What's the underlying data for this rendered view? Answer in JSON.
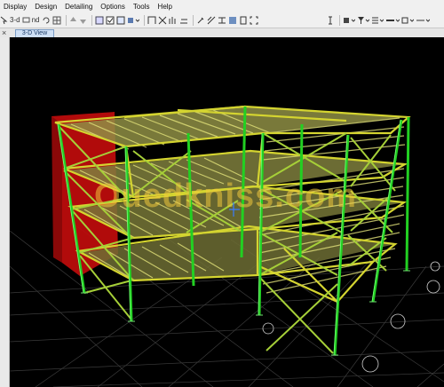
{
  "menu": {
    "items": [
      "Display",
      "Design",
      "Detailing",
      "Options",
      "Tools",
      "Help"
    ]
  },
  "toolbar": {
    "view_3d_label": "3-d",
    "plan_label": "nd"
  },
  "tabs": {
    "active_label": "3-D View",
    "close_glyph": "×"
  },
  "watermark": {
    "text": "Ouedkniss.com"
  },
  "colors": {
    "beam": "#c9c92c",
    "column": "#1dc41d",
    "brace": "#a8d23a",
    "wall": "#d81414",
    "deck": "#9a9a56",
    "grid": "#3c3c3c",
    "background": "#000000"
  }
}
